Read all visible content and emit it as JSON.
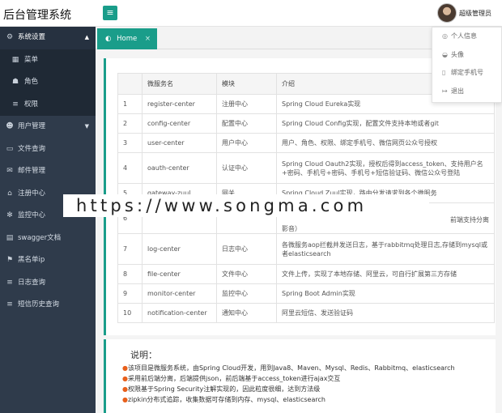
{
  "app": {
    "title": "后台管理系统",
    "user_name": "超级管理员"
  },
  "sidebar": {
    "items": [
      {
        "icon": "gear-icon",
        "glyph": "⚙",
        "label": "系统设置",
        "caret": "▲",
        "open": true
      },
      {
        "icon": "grid-icon",
        "glyph": "▦",
        "label": "菜单"
      },
      {
        "icon": "users-icon",
        "glyph": "☗",
        "label": "角色"
      },
      {
        "icon": "list-icon",
        "glyph": "≡",
        "label": "权限"
      },
      {
        "icon": "user-icon",
        "glyph": "☻",
        "label": "用户管理",
        "caret": "▼"
      },
      {
        "icon": "folder-icon",
        "glyph": "▭",
        "label": "文件查询"
      },
      {
        "icon": "mail-icon",
        "glyph": "✉",
        "label": "邮件管理"
      },
      {
        "icon": "bank-icon",
        "glyph": "⌂",
        "label": "注册中心"
      },
      {
        "icon": "spinner-icon",
        "glyph": "✻",
        "label": "监控中心"
      },
      {
        "icon": "file-icon",
        "glyph": "▤",
        "label": "swagger文档"
      },
      {
        "icon": "flag-icon",
        "glyph": "⚑",
        "label": "黑名单ip"
      },
      {
        "icon": "list-icon",
        "glyph": "≡",
        "label": "日志查询"
      },
      {
        "icon": "list-icon",
        "glyph": "≡",
        "label": "短信历史查询"
      }
    ]
  },
  "tabs": [
    {
      "label": "Home",
      "icon": "dashboard-icon",
      "glyph": "◐",
      "close": "×"
    }
  ],
  "dropdown": {
    "items": [
      {
        "icon": "user-circle-icon",
        "glyph": "◎",
        "label": "个人信息"
      },
      {
        "icon": "image-icon",
        "glyph": "◒",
        "label": "头像"
      },
      {
        "icon": "phone-icon",
        "glyph": "▯",
        "label": "绑定手机号"
      },
      {
        "icon": "logout-icon",
        "glyph": "↦",
        "label": "退出"
      }
    ]
  },
  "table": {
    "headers": [
      "",
      "微服务名",
      "模块",
      "介绍"
    ],
    "rows": [
      [
        "1",
        "register-center",
        "注册中心",
        "Spring Cloud Eureka实现"
      ],
      [
        "2",
        "config-center",
        "配置中心",
        "Spring Cloud Config实现，配置文件支持本地或者git"
      ],
      [
        "3",
        "user-center",
        "用户中心",
        "用户、角色、权限、绑定手机号、微信网页公众号授权"
      ],
      [
        "4",
        "oauth-center",
        "认证中心",
        "Spring Cloud Oauth2实现，授权后得到access_token、支持用户名+密码、手机号+密码、手机号+短信验证码、微信公众号登陆"
      ],
      [
        "5",
        "gateway-zuul",
        "网关",
        "Spring Cloud Zuul实现，路由分发请求到各个微服务"
      ],
      [
        "6",
        "",
        "",
        "影音）"
      ],
      [
        "7",
        "log-center",
        "日志中心",
        "各微服务aop拦截并发送日志，基于rabbitmq处理日志,存储到mysql或者elasticsearch"
      ],
      [
        "8",
        "file-center",
        "文件中心",
        "文件上传，实现了本地存储、阿里云，可自行扩展第三方存储"
      ],
      [
        "9",
        "monitor-center",
        "监控中心",
        "Spring Boot Admin实现"
      ],
      [
        "10",
        "notification-center",
        "通知中心",
        "阿里云短信、发送验证码"
      ]
    ],
    "row6_right_fragment": "前端支持分离"
  },
  "notes": {
    "title": "说明：",
    "bullet": "●",
    "items": [
      "该项目是微服务系统，由Spring Cloud开发，用到Java8、Maven、Mysql、Redis、Rabbitmq、elasticsearch",
      "采用前后端分离，后端提供json，前后端基于access_token进行ajax交互",
      "权限基于Spring Security注解实现的，因此粒度很细，达到方法级",
      "zipkin分布式追踪，收集数据可存储到内存、mysql、elasticsearch"
    ]
  },
  "watermark": "https://www.songma.com",
  "colors": {
    "accent": "#1a9d8a",
    "sidebar_bg": "#2f3b4b",
    "bullet": "#e8601c"
  }
}
